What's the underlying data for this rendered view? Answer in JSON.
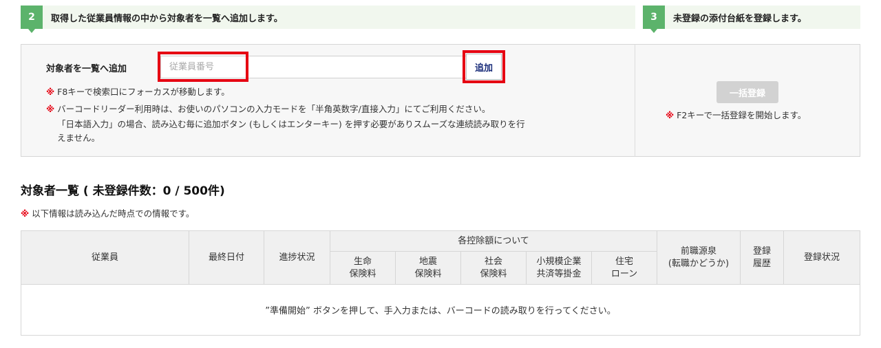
{
  "steps": [
    {
      "num": "2",
      "text": "取得した従業員情報の中から対象者を一覧へ追加します。"
    },
    {
      "num": "3",
      "text": "未登録の添付台紙を登録します。"
    }
  ],
  "add_panel": {
    "label": "対象者を一覧へ追加",
    "input_placeholder": "従業員番号",
    "add_button": "追加",
    "mark": "※",
    "notes": [
      "F8キーで検索口にフォーカスが移動します。",
      "バーコードリーダー利用時は、お使いのパソコンの入力モードを「半角英数字/直接入力」にてご利用ください。"
    ],
    "note_cont": [
      "「日本語入力」の場合、読み込む毎に追加ボタン (もしくはエンターキー) を押す必要がありスムーズな連続読み取りを行",
      "えません。"
    ]
  },
  "bulk_panel": {
    "button": "一括登録",
    "note": "F2キーで一括登録を開始します。"
  },
  "list": {
    "title": "対象者一覧 ( 未登録件数：0 / 500件)",
    "note": "以下情報は読み込んだ時点での情報です。",
    "headers": {
      "employee": "従業員",
      "last_date": "最終日付",
      "progress": "進捗状況",
      "deductions": "各控除額について",
      "life": [
        "生命",
        "保険料"
      ],
      "earthquake": [
        "地震",
        "保険料"
      ],
      "social": [
        "社会",
        "保険料"
      ],
      "small": [
        "小規模企業",
        "共済等掛金"
      ],
      "housing": [
        "住宅",
        "ローン"
      ],
      "prev_job": [
        "前職源泉",
        "(転職かどうか)"
      ],
      "history": [
        "登録",
        "履歴"
      ],
      "status": "登録状況"
    },
    "empty_message": "”準備開始” ボタンを押して、手入力または、バーコードの読み取りを行ってください。"
  }
}
